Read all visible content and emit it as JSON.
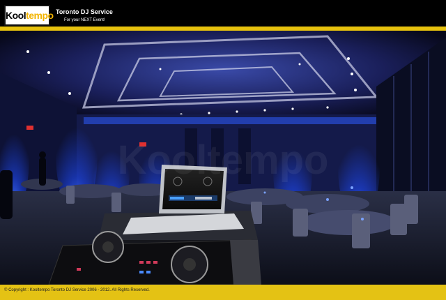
{
  "header": {
    "logo_text": "Kool",
    "logo_text_accent": "tempo",
    "brand": "Toronto DJ Service",
    "tagline": "For your NEXT Event!"
  },
  "photo": {
    "watermark": "Kooltempo"
  },
  "footer": {
    "copyright": "© Copyright : Kooltempo Toronto DJ Service 2006 - 2012.  All Rights Reserved."
  },
  "colors": {
    "accent_yellow": "#e7c20d",
    "uplight_blue": "#1f4cff",
    "background": "#000000"
  }
}
